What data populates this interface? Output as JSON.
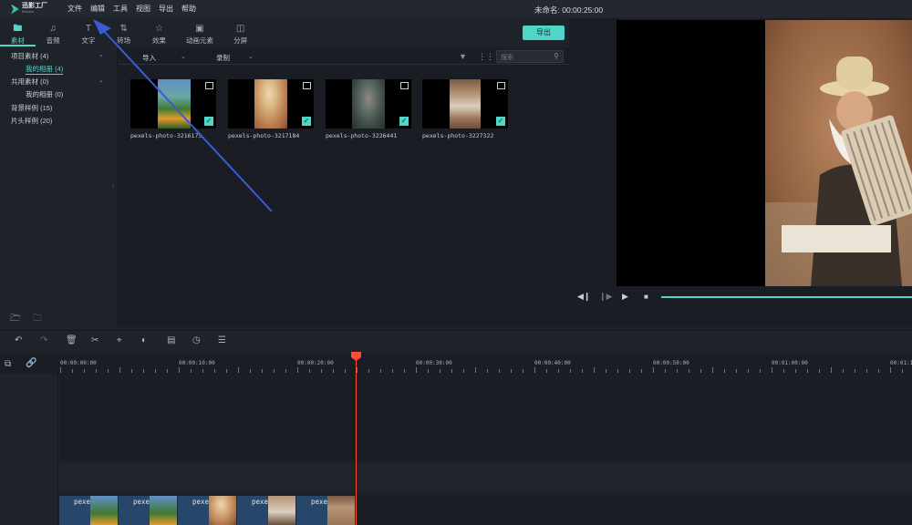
{
  "app": {
    "logo_text": "迅影工厂",
    "logo_sub": "Mvideo",
    "project_title": "未命名: 00:00:25:00"
  },
  "menu": [
    "文件",
    "编辑",
    "工具",
    "视图",
    "导出",
    "帮助"
  ],
  "tabs": [
    {
      "label": "素材",
      "icon": "folder-icon"
    },
    {
      "label": "音频",
      "icon": "music-note-icon"
    },
    {
      "label": "文字",
      "icon": "text-icon"
    },
    {
      "label": "转场",
      "icon": "transition-icon"
    },
    {
      "label": "效果",
      "icon": "effects-icon"
    },
    {
      "label": "动画元素",
      "icon": "image-icon"
    },
    {
      "label": "分屏",
      "icon": "split-screen-icon"
    }
  ],
  "export_label": "导出",
  "sidebar": {
    "items": [
      "项目素材 (4)",
      "我的相册 (4)",
      "共用素材 (0)",
      "我的相册 (0)",
      "背景样例 (15)",
      "片头样例 (20)"
    ]
  },
  "filterbar": {
    "import_label": "导入",
    "record_label": "录制",
    "search_placeholder": "搜索"
  },
  "media_items": [
    {
      "label": "pexels-photo-3216175"
    },
    {
      "label": "pexels-photo-3217184"
    },
    {
      "label": "pexels-photo-3226441"
    },
    {
      "label": "pexels-photo-3227322"
    }
  ],
  "ruler_labels": [
    "00:00:00:00",
    "00:00:10:00",
    "00:00:20:00",
    "00:00:30:00",
    "00:00:40:00",
    "00:00:50:00",
    "00:01:00:00",
    "00:01:10"
  ],
  "clips": [
    {
      "label": "pexels-ph"
    },
    {
      "label": "pexels-ph"
    },
    {
      "label": "pexels-ph"
    },
    {
      "label": "pexels-pe"
    },
    {
      "label": "pexels-ph"
    }
  ],
  "colors": {
    "accent": "#4fd6c8",
    "playhead": "#ff4b3a",
    "annotation_arrow": "#3b5bd6"
  }
}
